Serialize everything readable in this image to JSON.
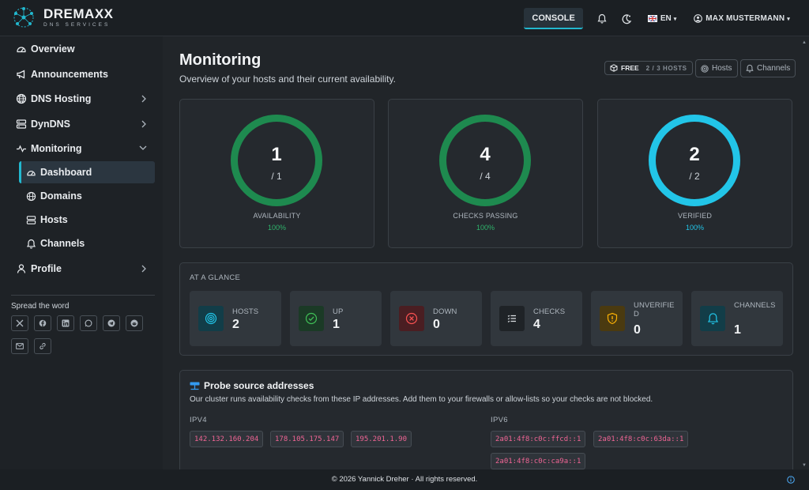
{
  "brand": {
    "name": "DREMAXX",
    "subtitle": "DNS SERVICES"
  },
  "topbar": {
    "console_label": "CONSOLE",
    "language": "EN",
    "user_name": "MAX MUSTERMANN"
  },
  "sidebar": {
    "items": [
      {
        "label": "Overview",
        "icon": "gauge-icon"
      },
      {
        "label": "Announcements",
        "icon": "megaphone-icon"
      },
      {
        "label": "DNS Hosting",
        "icon": "globe-icon"
      },
      {
        "label": "DynDNS",
        "icon": "server-icon"
      },
      {
        "label": "Monitoring",
        "icon": "activity-icon"
      },
      {
        "label": "Profile",
        "icon": "person-icon"
      }
    ],
    "subitems": [
      {
        "label": "Dashboard",
        "icon": "gauge-icon",
        "active": true
      },
      {
        "label": "Domains",
        "icon": "globe-icon"
      },
      {
        "label": "Hosts",
        "icon": "server-icon"
      },
      {
        "label": "Channels",
        "icon": "bell-icon"
      }
    ],
    "spread_label": "Spread the word",
    "social": [
      "x-icon",
      "facebook-icon",
      "linkedin-icon",
      "whatsapp-icon",
      "telegram-icon",
      "reddit-icon",
      "mail-icon",
      "link-icon"
    ]
  },
  "header": {
    "title": "Monitoring",
    "subtitle": "Overview of your hosts and their current availability.",
    "plan": "FREE",
    "plan_usage": "2 / 3 HOSTS",
    "hosts_button": "Hosts",
    "channels_button": "Channels"
  },
  "stats": [
    {
      "value": "1",
      "total": "/ 1",
      "label": "AVAILABILITY",
      "percent": "100%",
      "color": "#1e8a4f"
    },
    {
      "value": "4",
      "total": "/ 4",
      "label": "CHECKS PASSING",
      "percent": "100%",
      "color": "#1e8a4f"
    },
    {
      "value": "2",
      "total": "/ 2",
      "label": "VERIFIED",
      "percent": "100%",
      "color": "#22c5e8"
    }
  ],
  "glance": {
    "title": "AT A GLANCE",
    "tiles": [
      {
        "label": "HOSTS",
        "value": "2",
        "icon": "target-icon",
        "color": "#22c5e8"
      },
      {
        "label": "UP",
        "value": "1",
        "icon": "check-circle-icon",
        "color": "#40c057"
      },
      {
        "label": "DOWN",
        "value": "0",
        "icon": "x-circle-icon",
        "color": "#fa5252"
      },
      {
        "label": "CHECKS",
        "value": "4",
        "icon": "checklist-icon",
        "color": "#dee2e6"
      },
      {
        "label": "UNVERIFIED",
        "value": "0",
        "icon": "shield-alert-icon",
        "color": "#fab005"
      },
      {
        "label": "CHANNELS",
        "value": "1",
        "icon": "bell-icon",
        "color": "#22c5e8"
      }
    ]
  },
  "probe": {
    "title": "Probe source addresses",
    "description": "Our cluster runs availability checks from these IP addresses. Add them to your firewalls or allow-lists so your checks are not blocked.",
    "ipv4_label": "IPV4",
    "ipv6_label": "IPV6",
    "ipv4": [
      "142.132.160.204",
      "178.105.175.147",
      "195.201.1.90"
    ],
    "ipv6": [
      "2a01:4f8:c0c:ffcd::1",
      "2a01:4f8:c0c:63da::1",
      "2a01:4f8:c0c:ca9a::1"
    ]
  },
  "footer": {
    "text": "© 2026 Yannick Dreher · All rights reserved."
  }
}
